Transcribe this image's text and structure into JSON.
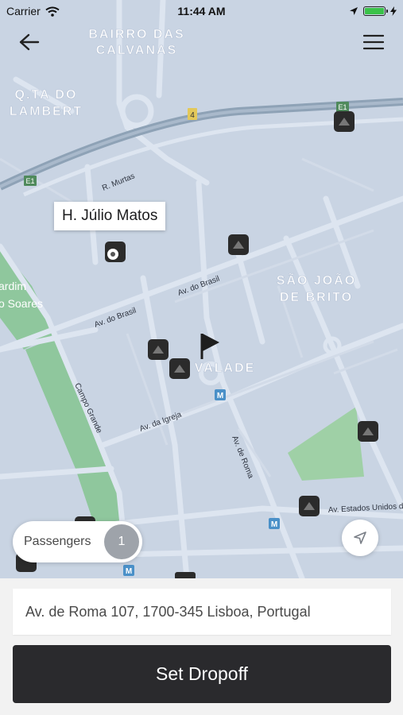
{
  "status_bar": {
    "carrier": "Carrier",
    "time": "11:44 AM",
    "battery_level": 1.0,
    "battery_color": "#3ac24a"
  },
  "nav": {
    "back_icon": "arrow-left-icon",
    "menu_icon": "hamburger-menu-icon"
  },
  "map": {
    "area_labels": [
      {
        "line1": "BAIRRO DAS",
        "line2": "CALVANAS"
      },
      {
        "line1": "Q.TA DO",
        "line2": "LAMBERT"
      },
      {
        "line1": "SÃO JOÃO",
        "line2": "DE BRITO"
      },
      {
        "line1": "VALADE",
        "line2": ""
      }
    ],
    "street_labels": [
      "R. Murtas",
      "Av. do Brasil",
      "Av. do Brasil",
      "Campo Grande",
      "Av. da Igreja",
      "Av. de Roma",
      "Av. Estados Unidos da"
    ],
    "road_shields": [
      "4",
      "E1",
      "E1"
    ],
    "park_labels": [
      "ardim",
      "o Soares"
    ],
    "metro_icon": "metro-icon",
    "destination_icon": "flag-icon",
    "place_icon": "landmark-icon",
    "colors": {
      "land": "#c9d4e3",
      "road": "#dde5f0",
      "highway": "#8ea2b6",
      "park": "#8fc79d",
      "marker": "#2b2b2b"
    }
  },
  "callout": {
    "title": "H. Júlio Matos"
  },
  "passengers": {
    "label": "Passengers",
    "count": "1"
  },
  "locate_icon": "location-arrow-icon",
  "address": {
    "value": "Av. de Roma 107, 1700-345 Lisboa, Portugal"
  },
  "set_dropoff": {
    "label": "Set Dropoff"
  }
}
